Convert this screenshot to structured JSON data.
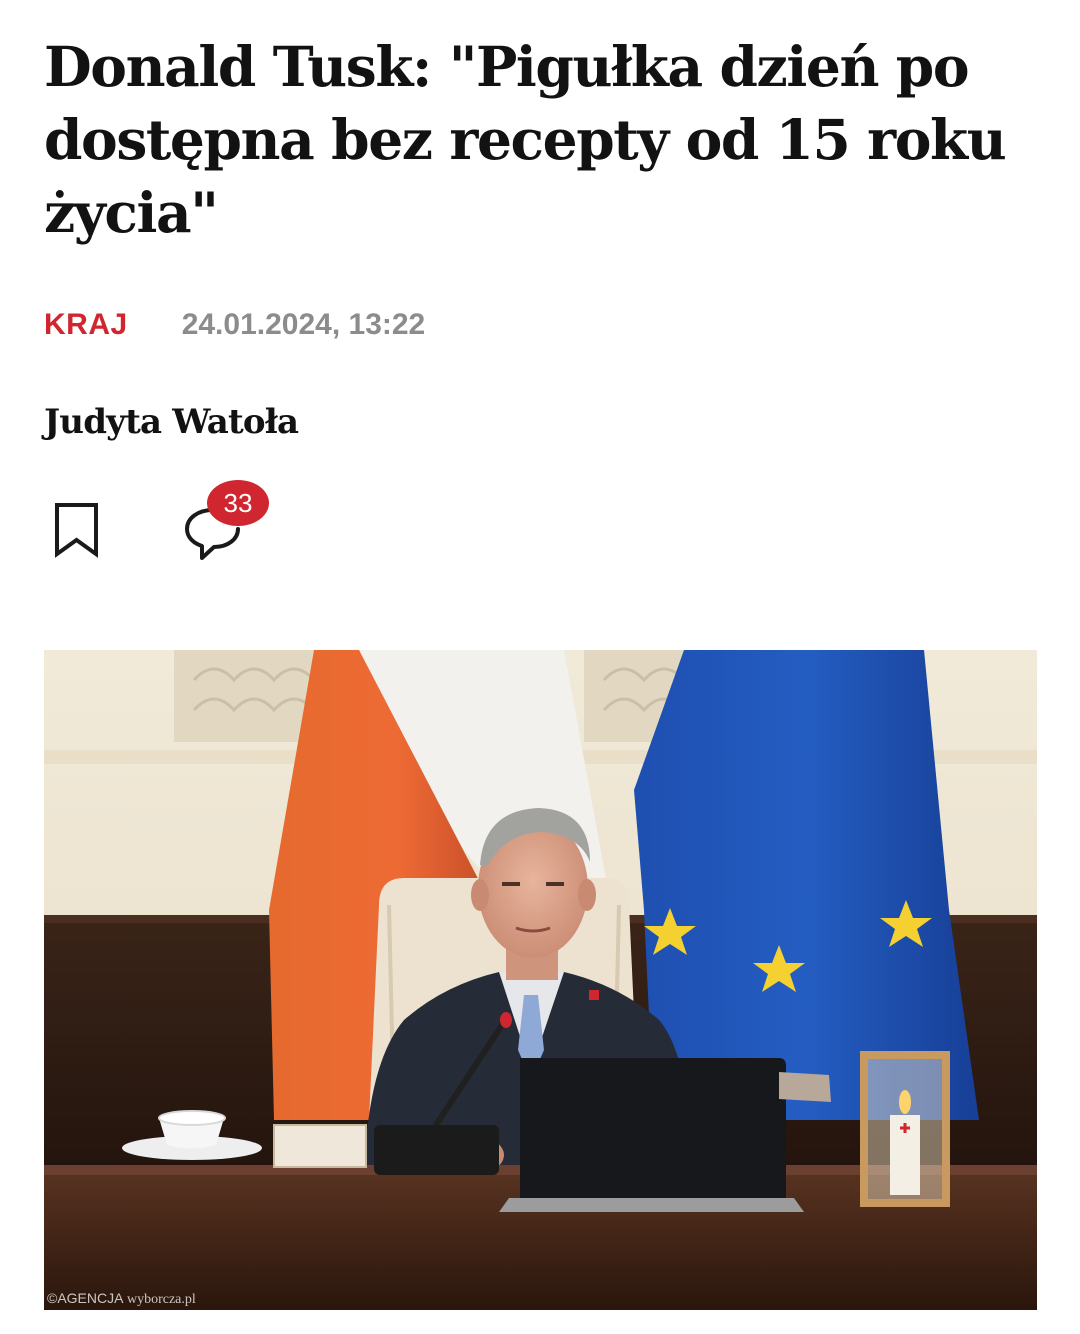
{
  "article": {
    "title": "Donald Tusk: \"Pigułka dzień po dostępna bez recepty od 15 roku życia\"",
    "category": "KRAJ",
    "date": "24.01.2024, 13:22",
    "author": "Judyta Watoła"
  },
  "actions": {
    "bookmark_icon": "bookmark-icon",
    "comments_icon": "comment-bubble-icon",
    "comments_count": "33"
  },
  "image": {
    "credit_agency": "©AGENCJA",
    "credit_site": "wyborcza.pl"
  },
  "colors": {
    "accent": "#d0262f",
    "title": "#121212",
    "date": "#8c8c8c"
  }
}
